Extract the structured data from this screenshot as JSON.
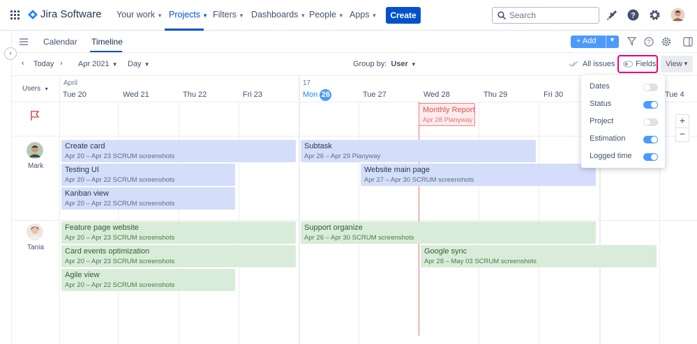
{
  "nav": {
    "logo_text": "Jira Software",
    "items": [
      {
        "label": "Your work"
      },
      {
        "label": "Projects"
      },
      {
        "label": "Filters"
      },
      {
        "label": "Dashboards"
      },
      {
        "label": "People"
      },
      {
        "label": "Apps"
      }
    ],
    "create_label": "Create",
    "search_placeholder": "Search"
  },
  "tabs": [
    {
      "label": "Calendar"
    },
    {
      "label": "Timeline"
    }
  ],
  "add_label": "Add",
  "toolbar": {
    "today": "Today",
    "month": "Apr 2021",
    "scale": "Day",
    "group_by_label": "Group by:",
    "group_by_value": "User",
    "all_issues": "All issues",
    "fields": "Fields",
    "view": "View"
  },
  "timeline": {
    "users_label": "Users",
    "month_labels": [
      "April",
      "17"
    ],
    "days": [
      "Tue 20",
      "Wed 21",
      "Thu 22",
      "Fri 23",
      "Mon",
      "Tue 27",
      "Wed 28",
      "Thu 29",
      "Fri 30",
      "Tue 4"
    ],
    "today_number": "26"
  },
  "milestone": {
    "title": "Monthly Report",
    "sub": "Apr 28  Planyway"
  },
  "users": [
    {
      "name": "Mark",
      "cards": [
        {
          "title": "Create card",
          "sub": "Apr 20 – Apr 23  SCRUM screenshots"
        },
        {
          "title": "Subtask",
          "sub": "Apr 26 – Apr 29  Planyway"
        },
        {
          "title": "Testing UI",
          "sub": "Apr 20 – Apr 22  SCRUM screenshots"
        },
        {
          "title": "Website main page",
          "sub": "Apr 27 – Apr 30  SCRUM screenshots"
        },
        {
          "title": "Kanban view",
          "sub": "Apr 20 – Apr 22  SCRUM screenshots"
        }
      ]
    },
    {
      "name": "Tania",
      "cards": [
        {
          "title": "Feature page website",
          "sub": "Apr 20 – Apr 23  SCRUM screenshots"
        },
        {
          "title": "Support organize",
          "sub": "Apr 26 – Apr 30  SCRUM screenshots"
        },
        {
          "title": "Card events optimization",
          "sub": "Apr 20 – Apr 23  SCRUM screenshots"
        },
        {
          "title": "Google sync",
          "sub": "Apr 28 – May 03  SCRUM screenshots"
        },
        {
          "title": "Agile view",
          "sub": "Apr 20 – Apr 22  SCRUM screenshots"
        }
      ]
    }
  ],
  "fields_menu": [
    {
      "label": "Dates",
      "on": false
    },
    {
      "label": "Status",
      "on": true
    },
    {
      "label": "Project",
      "on": false
    },
    {
      "label": "Estimation",
      "on": true
    },
    {
      "label": "Logged time",
      "on": true
    }
  ],
  "colors": {
    "accent": "#0052cc",
    "today": "#e57373",
    "highlight": "#e6007e"
  }
}
